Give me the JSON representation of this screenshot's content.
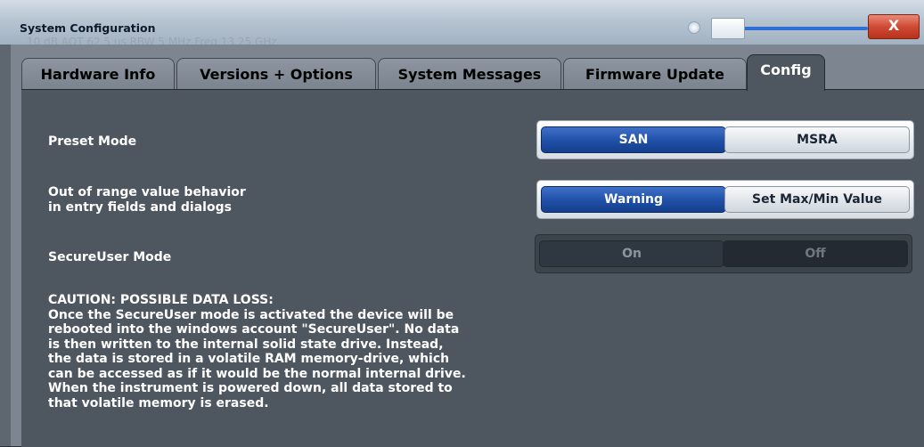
{
  "window": {
    "title": "System Configuration",
    "ghost_status": "10 dB   AQT 62.5 µs   RBW 5 MHz   Freq 13.25 GHz",
    "close_label": "X"
  },
  "tabs": [
    {
      "label": "Hardware Info",
      "active": false
    },
    {
      "label": "Versions + Options",
      "active": false
    },
    {
      "label": "System Messages",
      "active": false
    },
    {
      "label": "Firmware Update",
      "active": false
    },
    {
      "label": "Config",
      "active": true
    }
  ],
  "config": {
    "preset_mode": {
      "label": "Preset Mode",
      "options": [
        "SAN",
        "MSRA"
      ],
      "selected": "SAN"
    },
    "out_of_range": {
      "label_line1": "Out of range value behavior",
      "label_line2": "in entry fields and dialogs",
      "options": [
        "Warning",
        "Set Max/Min Value"
      ],
      "selected": "Warning"
    },
    "secure_user": {
      "label": "SecureUser Mode",
      "options": [
        "On",
        "Off"
      ],
      "enabled": false
    },
    "caution_text": "CAUTION: POSSIBLE DATA LOSS:\nOnce the SecureUser mode is activated the device will be\nrebooted into the windows account \"SecureUser\". No data\nis then written to the internal solid state drive. Instead,\nthe data is stored in a volatile RAM memory-drive, which\ncan be accessed as if it would be the normal internal drive.\nWhen the instrument is powered down, all data stored to\nthat volatile memory is erased."
  },
  "colors": {
    "selected_blue": "#1f4fa6",
    "panel_bg": "#4e5760",
    "close_red": "#cf4a34"
  }
}
